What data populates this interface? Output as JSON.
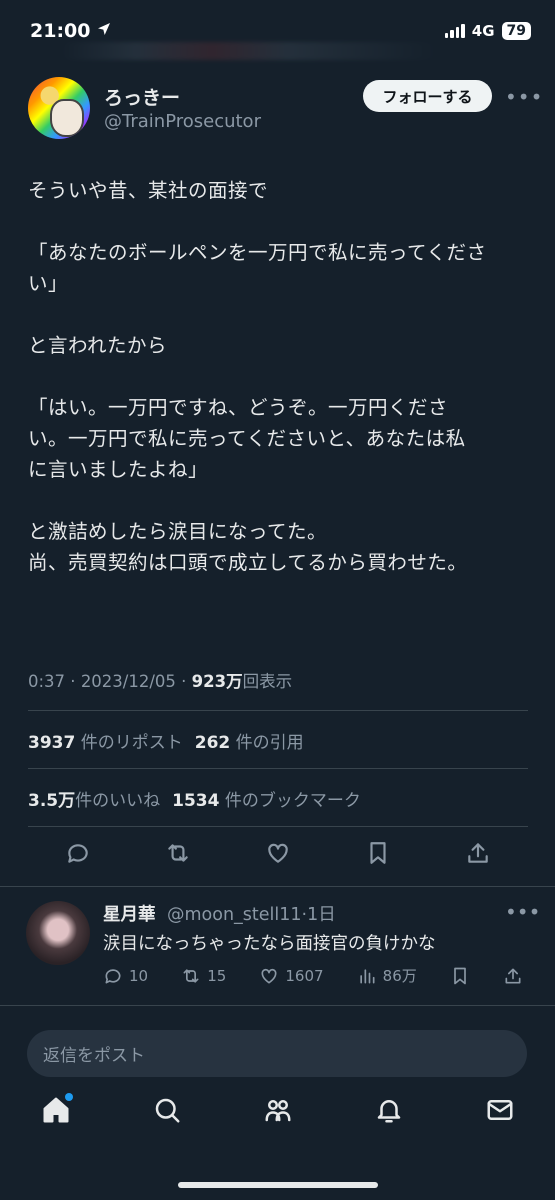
{
  "status": {
    "time": "21:00",
    "network": "4G",
    "battery": "79"
  },
  "author": {
    "name": "ろっきー",
    "handle": "@TrainProsecutor",
    "follow_label": "フォローする"
  },
  "tweet": {
    "text": "そういや昔、某社の面接で\n\n「あなたのボールペンを一万円で私に売ってくださ\nい」\n\nと言われたから\n\n「はい。一万円ですね、どうぞ。一万円くださ\nい。一万円で私に売ってくださいと、あなたは私\nに言いましたよね」\n\nと激詰めしたら涙目になってた。\n尚、売買契約は口頭で成立してるから買わせた。",
    "time": "0:37",
    "date": "2023/12/05",
    "views_count": "923万",
    "views_label": "回表示"
  },
  "stats": {
    "reposts_count": "3937",
    "reposts_label": "件のリポスト",
    "quotes_count": "262",
    "quotes_label": "件の引用",
    "likes_count": "3.5万",
    "likes_label": "件のいいね",
    "bookmarks_count": "1534",
    "bookmarks_label": "件のブックマーク"
  },
  "reply": {
    "name": "星月華",
    "handle": "@moon_stell11",
    "age": "1日",
    "text": "涙目になっちゃったなら面接官の負けかな",
    "replies": "10",
    "reposts": "15",
    "likes": "1607",
    "views": "86万"
  },
  "composer": {
    "placeholder": "返信をポスト"
  },
  "colors": {
    "background": "#15202b",
    "text": "#e7e9ea",
    "muted": "#8b98a5",
    "accent": "#1d9bf0"
  },
  "icons": [
    "reply-icon",
    "repost-icon",
    "like-icon",
    "bookmark-icon",
    "share-icon",
    "home-icon",
    "search-icon",
    "communities-icon",
    "notifications-icon",
    "messages-icon"
  ]
}
